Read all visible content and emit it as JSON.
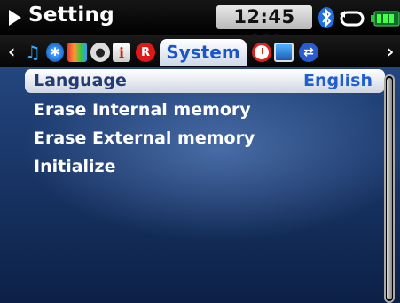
{
  "titlebar": {
    "title": "Setting",
    "clock": "12:45 AM",
    "icons": [
      "play-arrow-icon",
      "bluetooth-icon",
      "repeat-icon",
      "battery-icon"
    ]
  },
  "tabs": {
    "icons": [
      "music-icon",
      "bluetooth-icon",
      "display-icon",
      "radio-icon",
      "info-icon",
      "record-icon",
      "clock-icon",
      "screen-icon",
      "sync-icon"
    ],
    "record_glyph": "R",
    "info_glyph": "i",
    "active_label": "System"
  },
  "menu": {
    "items": [
      {
        "label": "Language",
        "value": "English",
        "selected": true
      },
      {
        "label": "Erase Internal memory"
      },
      {
        "label": "Erase External memory"
      },
      {
        "label": "Initialize"
      }
    ]
  },
  "colors": {
    "accent": "#1f5fd0",
    "background_top": "#23467f",
    "background_bottom": "#0c2046",
    "selection": "#ffffff"
  }
}
